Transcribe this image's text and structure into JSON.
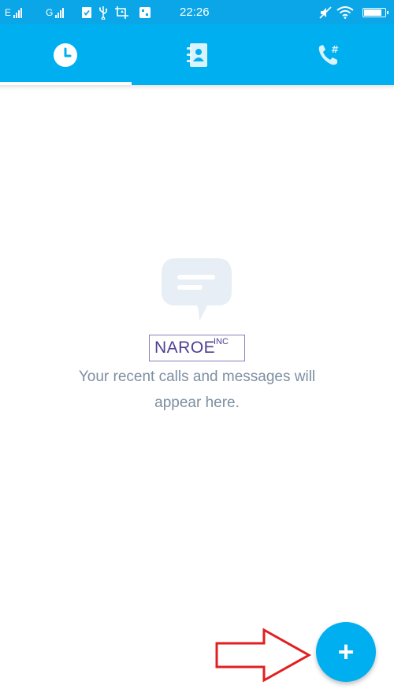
{
  "status_bar": {
    "carrier1_label": "E",
    "carrier2_label": "G",
    "time": "22:26"
  },
  "tabs": [
    {
      "name": "recent",
      "icon": "clock-icon",
      "active": true
    },
    {
      "name": "contacts",
      "icon": "contacts-book-icon",
      "active": false
    },
    {
      "name": "dialpad",
      "icon": "phone-dialpad-icon",
      "active": false
    }
  ],
  "empty_state": {
    "icon": "chat-bubble-icon",
    "message_line1": "Your recent calls and messages will",
    "message_line2": "appear here."
  },
  "watermark": {
    "name": "NAROE",
    "suffix": "INC"
  },
  "fab": {
    "icon": "plus-icon",
    "label": "+"
  },
  "annotation": {
    "icon": "red-arrow-icon"
  },
  "colors": {
    "accent": "#00aff0",
    "status_bar": "#0ba6e8",
    "message_text": "#7d8fa1",
    "annotation_arrow": "#e02020"
  }
}
